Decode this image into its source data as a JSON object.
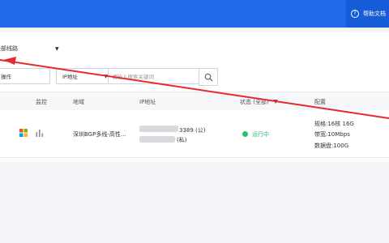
{
  "header": {
    "help_label": "帮助文档",
    "help_icon": "question-circle-icon",
    "help_icon_char": "?",
    "accent": "#1f6ae8"
  },
  "filter": {
    "region_label": "全部线路",
    "caret": "▼"
  },
  "toolbar": {
    "batch_label": "操作",
    "search_type_label": "IP地址",
    "search_placeholder": "请输入搜索关键词",
    "search_icon": "search-icon"
  },
  "table": {
    "columns": {
      "monitor": "监控",
      "region": "地域",
      "ip": "IP地址",
      "status": "状态 (全部)",
      "config": "配置"
    },
    "rows": [
      {
        "os_icon": "windows-icon",
        "monitor_icon": "bar-chart-icon",
        "region": "深圳BGP多线-高性...",
        "ip_public": "3389 (公)",
        "ip_private": "(私)",
        "status": "运行中",
        "status_color": "#2bbf6c",
        "spec": "规格:16核 16G",
        "bandwidth": "带宽:10Mbps",
        "disk": "数据盘:100G"
      }
    ]
  },
  "annotation_color": "#e8282b"
}
